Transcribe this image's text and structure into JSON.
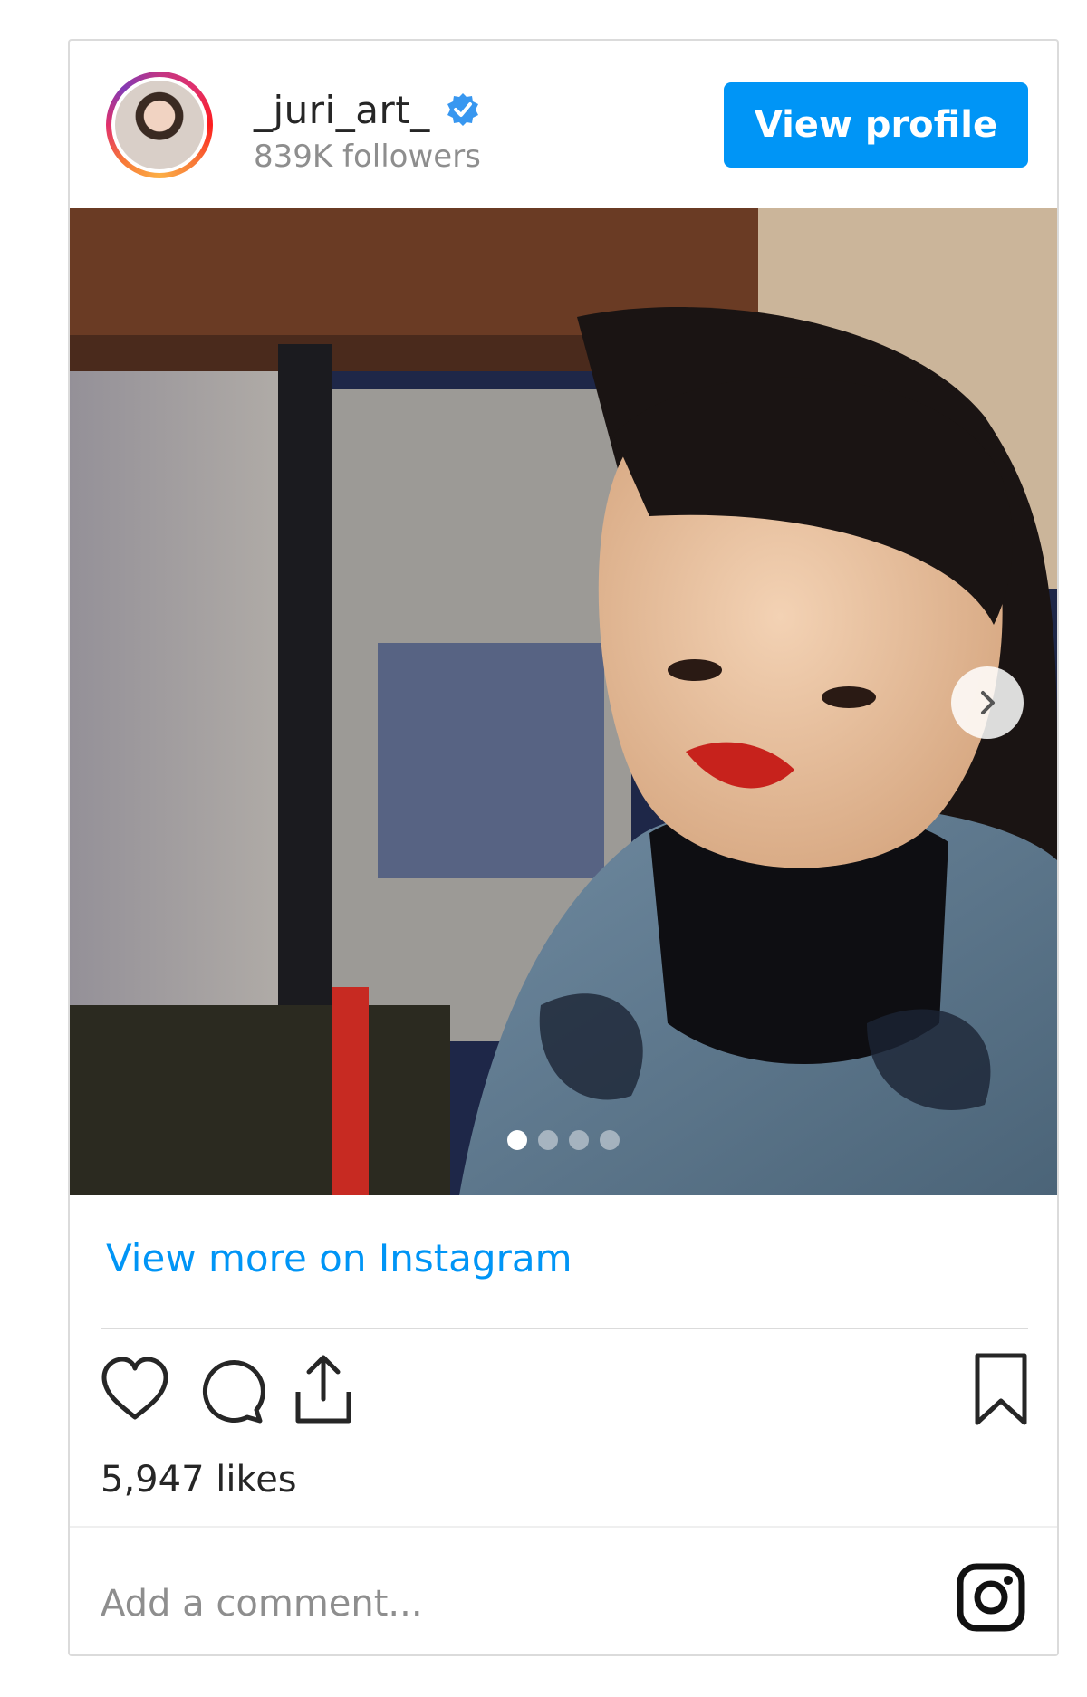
{
  "header": {
    "username": "_juri_art_",
    "followers": "839K followers",
    "view_profile_label": "View profile",
    "verified": true
  },
  "post": {
    "carousel": {
      "total": 4,
      "active_index": 0
    }
  },
  "links": {
    "view_more": "View more on Instagram"
  },
  "stats": {
    "likes": "5,947 likes"
  },
  "comment": {
    "placeholder": "Add a comment..."
  },
  "colors": {
    "accent": "#0095f6",
    "text": "#262626",
    "muted": "#8e8e8e",
    "border": "#dbdbdb"
  },
  "icons": {
    "like": "heart-icon",
    "comment": "comment-icon",
    "share": "share-icon",
    "save": "bookmark-icon",
    "brand": "instagram-icon",
    "verified": "verified-badge-icon",
    "next": "chevron-right-icon"
  }
}
